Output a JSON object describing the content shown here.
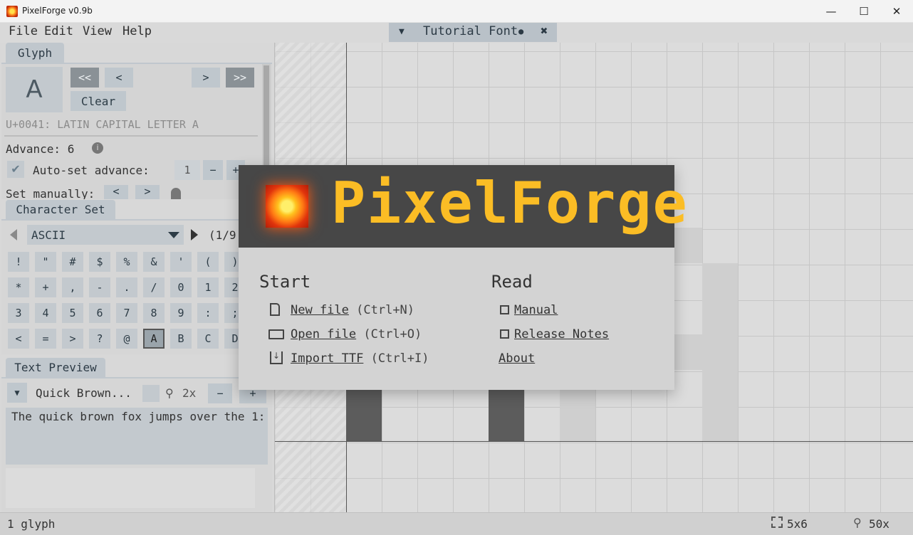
{
  "window": {
    "title": "PixelForge v0.9b",
    "min": "—",
    "max": "☐",
    "close": "✕"
  },
  "menu": [
    "File",
    "Edit",
    "View",
    "Help"
  ],
  "file_tab": {
    "name": "Tutorial Font",
    "modified": "●",
    "close": "✖",
    "dropdown": "▼"
  },
  "glyph_panel": {
    "tab": "Glyph",
    "char": "A",
    "nav": [
      "<<",
      "<",
      ">",
      ">>"
    ],
    "clear": "Clear",
    "codepoint": "U+0041: LATIN CAPITAL LETTER A",
    "advance": "Advance: 6",
    "auto_label": "Auto-set advance:",
    "auto_value": "1",
    "minus": "−",
    "plus": "+",
    "manual_label": "Set manually:",
    "manual_left": "<",
    "manual_right": ">"
  },
  "charset_panel": {
    "tab": "Character Set",
    "select": "ASCII",
    "page": "(1/9",
    "chars": [
      [
        "!",
        "\"",
        "#",
        "$",
        "%",
        "&",
        "'",
        "(",
        ")"
      ],
      [
        "*",
        "+",
        ",",
        "-",
        ".",
        "/",
        "0",
        "1",
        "2"
      ],
      [
        "3",
        "4",
        "5",
        "6",
        "7",
        "8",
        "9",
        ":",
        ";"
      ],
      [
        "<",
        "=",
        ">",
        "?",
        "@",
        "A",
        "B",
        "C",
        "D"
      ]
    ]
  },
  "text_preview": {
    "tab": "Text Preview",
    "preset": "Quick Brown...",
    "zoom": "2x",
    "minus": "−",
    "plus": "+",
    "text": "The quick brown fox jumps over the 1:"
  },
  "status": {
    "glyphs": "1 glyph",
    "size": "5x6",
    "zoom": "50x"
  },
  "dialog": {
    "logo": "PixelForge",
    "start_title": "Start",
    "read_title": "Read",
    "start_items": [
      {
        "label": "New file",
        "shortcut": "(Ctrl+N)"
      },
      {
        "label": "Open file",
        "shortcut": "(Ctrl+O)"
      },
      {
        "label": "Import TTF",
        "shortcut": "(Ctrl+I)"
      }
    ],
    "read_items": [
      "Manual",
      "Release Notes",
      "About"
    ]
  }
}
